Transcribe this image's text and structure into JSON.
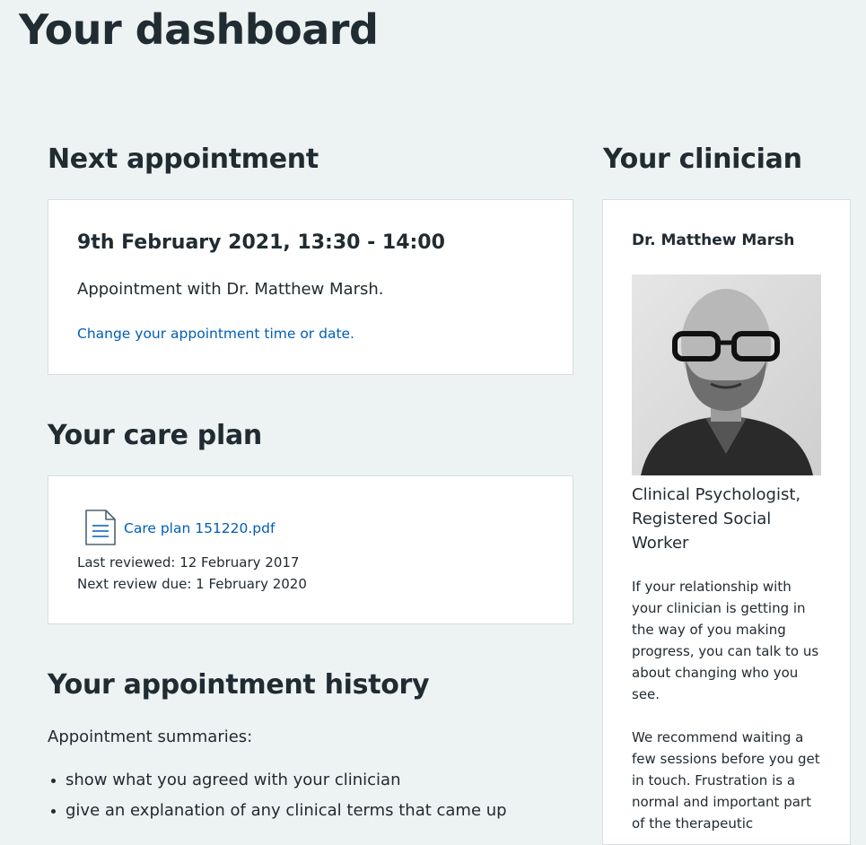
{
  "page": {
    "title": "Your dashboard"
  },
  "next_appointment": {
    "heading": "Next appointment",
    "datetime": "9th February 2021, 13:30 - 14:00",
    "with_text": "Appointment with Dr. Matthew Marsh.",
    "change_link": "Change your appointment time or date."
  },
  "care_plan": {
    "heading": "Your care plan",
    "file_icon": "document-icon",
    "file_link": "Care plan 151220.pdf",
    "last_reviewed": "Last reviewed: 12 February 2017",
    "next_review": "Next review due: 1 February 2020"
  },
  "history": {
    "heading": "Your appointment history",
    "intro": "Appointment summaries:",
    "items": [
      "show what you agreed with your clinician",
      "give an explanation of any clinical terms that came up"
    ]
  },
  "clinician": {
    "heading": "Your clinician",
    "name": "Dr. Matthew Marsh",
    "role": "Clinical Psychologist, Registered Social Worker",
    "para1": "If your relationship with your clinician is getting in the way of you making progress, you can talk to us about changing who you see.",
    "para2": "We recommend waiting a few sessions before you get in touch. Frustration is a normal and important part of the therapeutic"
  },
  "colors": {
    "background": "#edf2f2",
    "text": "#212b32",
    "link": "#005eb8",
    "card": "#ffffff",
    "card_border": "#d8dde0"
  }
}
